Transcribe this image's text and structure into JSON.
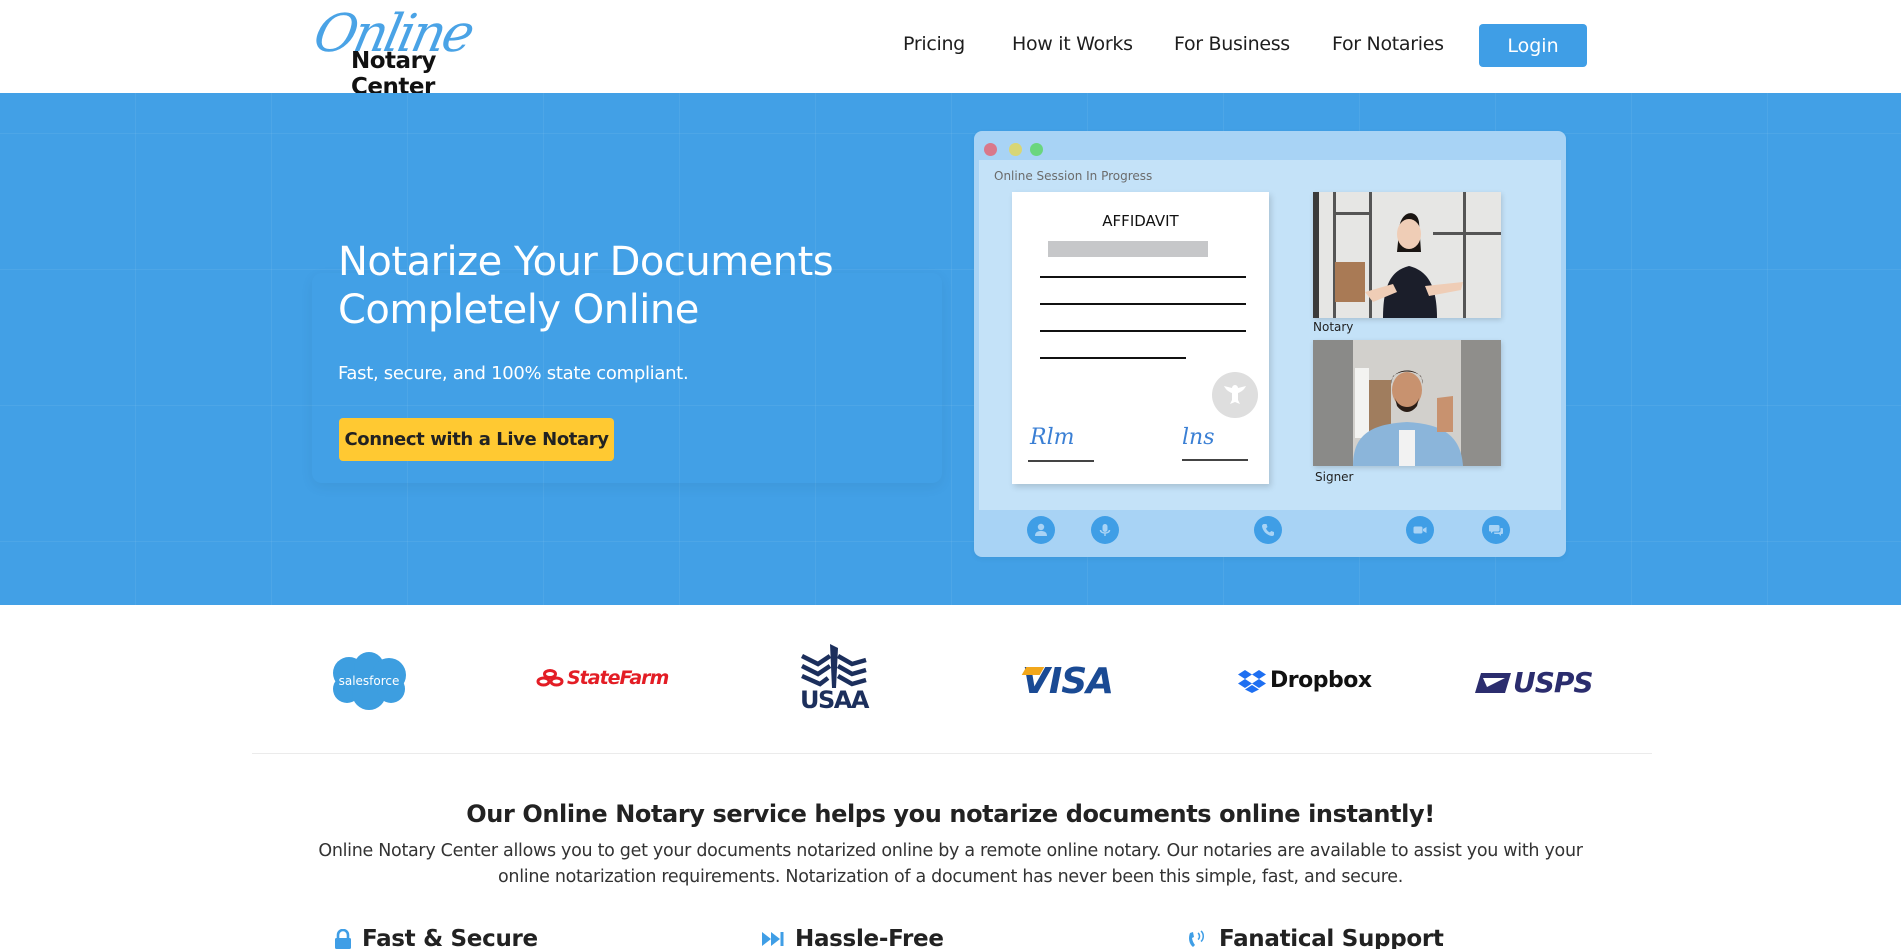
{
  "header": {
    "logo": {
      "script": "Online",
      "main": "Notary Center"
    },
    "nav": [
      {
        "label": "Pricing"
      },
      {
        "label": "How it Works"
      },
      {
        "label": "For Business"
      },
      {
        "label": "For Notaries"
      }
    ],
    "login_label": "Login"
  },
  "hero": {
    "title": "Notarize Your Documents Completely Online",
    "subtitle": "Fast, secure, and 100% state compliant.",
    "cta_label": "Connect with a Live Notary",
    "mock": {
      "session_label": "Online Session In Progress",
      "document_title": "AFFIDAVIT",
      "videos": [
        {
          "label": "Notary",
          "image": "notary-video"
        },
        {
          "label": "Signer",
          "image": "signer-video"
        }
      ],
      "controls": [
        "user-icon",
        "microphone-icon",
        "phone-icon",
        "video-camera-icon",
        "chat-icon"
      ]
    }
  },
  "logos": [
    {
      "name": "salesforce",
      "text": "salesforce"
    },
    {
      "name": "statefarm",
      "text": "StateFarm"
    },
    {
      "name": "usaa",
      "text": "USAA"
    },
    {
      "name": "visa",
      "text": "VISA"
    },
    {
      "name": "dropbox",
      "text": "Dropbox"
    },
    {
      "name": "usps",
      "text": "USPS"
    }
  ],
  "intro": {
    "title": "Our Online Notary service helps you notarize documents online instantly!",
    "body": "Online Notary Center allows you to get your documents notarized online by a remote online notary. Our notaries are available to assist you with your online notarization requirements. Notarization of a document has never been this simple, fast, and secure."
  },
  "features": [
    {
      "title": "Fast & Secure",
      "icon": "lock-icon"
    },
    {
      "title": "Hassle-Free",
      "icon": "fast-forward-icon"
    },
    {
      "title": "Fanatical Support",
      "icon": "phone-signal-icon"
    }
  ],
  "colors": {
    "primary": "#42a0e6",
    "cta": "#ffc932",
    "text": "#222222"
  }
}
